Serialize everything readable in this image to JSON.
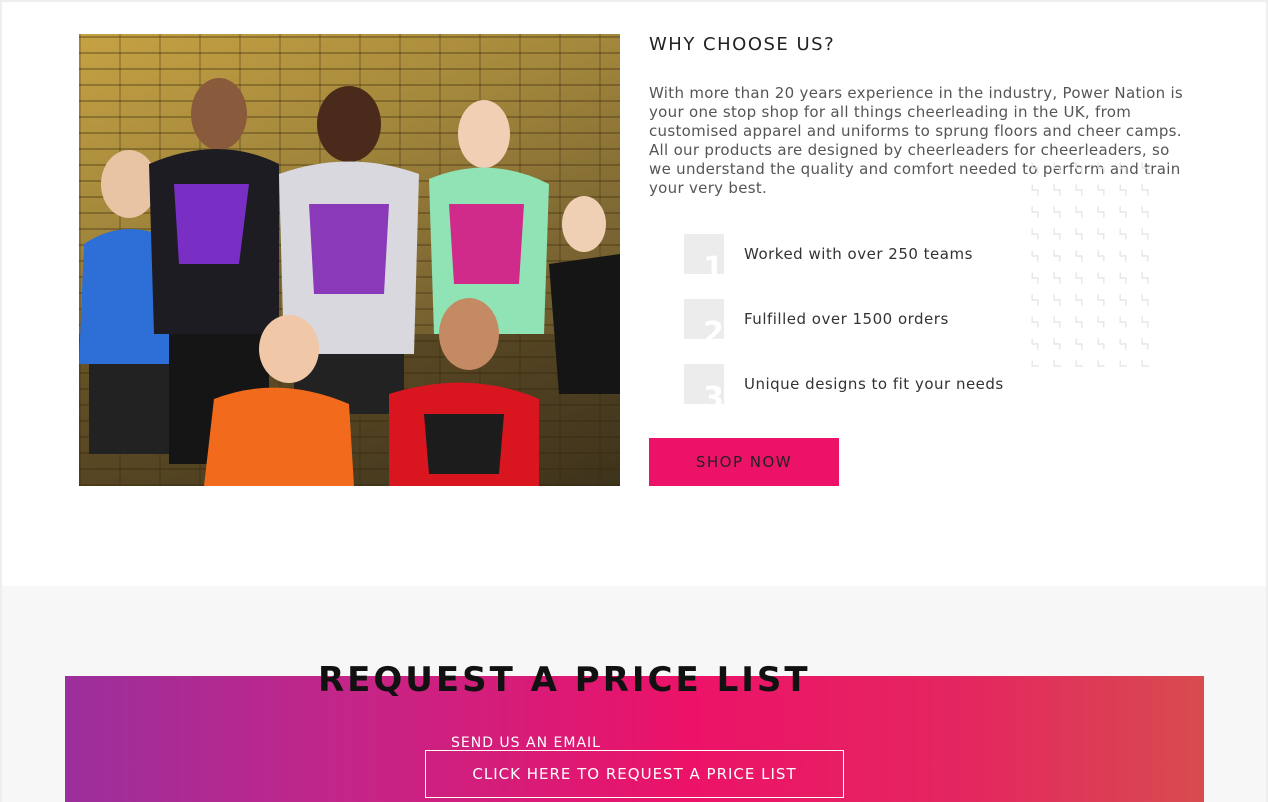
{
  "why": {
    "title": "WHY CHOOSE US?",
    "text": "With more than 20 years experience in the industry, Power Nation is your one stop shop for all things cheerleading in the UK, from customised apparel and uniforms to sprung floors and cheer camps. All our products are designed by cheerleaders for cheerleaders, so we understand the quality and comfort needed to perform and train your very best.",
    "features": [
      {
        "number": "1",
        "label": "Worked with over 250 teams"
      },
      {
        "number": "2",
        "label": "Fulfilled over 1500 orders"
      },
      {
        "number": "3",
        "label": "Unique designs to fit your needs"
      }
    ],
    "shop_button": "SHOP NOW"
  },
  "price_list": {
    "title": "REQUEST A PRICE LIST",
    "send_label": "SEND US AN EMAIL",
    "button": "CLICK HERE TO REQUEST A PRICE LIST"
  },
  "colors": {
    "accent": "#ec1268",
    "gradient_start": "#9b2f9c",
    "gradient_end": "#d84b4f"
  }
}
